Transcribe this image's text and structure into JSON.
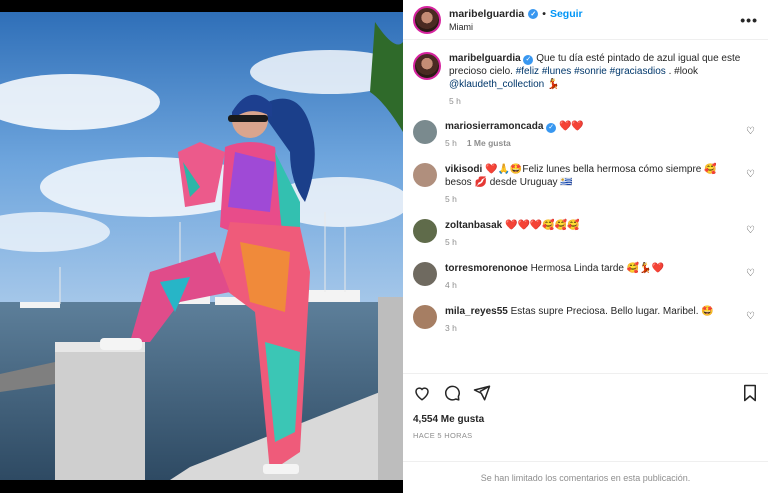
{
  "post": {
    "author": "maribelguardia",
    "follow_label": "Seguir",
    "location": "Miami",
    "more_icon": "more-options-icon"
  },
  "caption": {
    "author": "maribelguardia",
    "text_before": "Que tu día esté pintado de azul igual que este precioso cielo.",
    "hashtags": "#feliz #lunes #sonrie #graciasdios",
    "mid": ". #look",
    "mention": "@klaudeth_collection",
    "emoji": "💃",
    "time": "5 h"
  },
  "comments": [
    {
      "user": "mariosierramoncada",
      "verified": true,
      "text": "❤️❤️",
      "time": "5 h",
      "likes": "1 Me gusta",
      "avatar_color": "#7a8a8e"
    },
    {
      "user": "vikisodi",
      "verified": false,
      "text": "❤️🙏🤩Feliz lunes bella hermosa cómo siempre 🥰 besos 💋 desde Uruguay 🇺🇾",
      "time": "5 h",
      "likes": "",
      "avatar_color": "#b08f7d"
    },
    {
      "user": "zoltanbasak",
      "verified": false,
      "text": "❤️❤️❤️🥰🥰🥰",
      "time": "5 h",
      "likes": "",
      "avatar_color": "#5f6b4a"
    },
    {
      "user": "torresmorenonoe",
      "verified": false,
      "text": "Hermosa Linda tarde 🥰💃❤️",
      "time": "4 h",
      "likes": "",
      "avatar_color": "#6f6a60"
    },
    {
      "user": "mila_reyes55",
      "verified": false,
      "text": "Estas supre Preciosa. Bello lugar. Maribel. 🤩",
      "time": "3 h",
      "likes": "",
      "avatar_color": "#a67e63"
    }
  ],
  "footer": {
    "likes": "4,554 Me gusta",
    "when": "HACE 5 HORAS",
    "closed_msg": "Se han limitado los comentarios en esta publicación."
  },
  "colors": {
    "accent": "#0095f6",
    "sky": "#4a86c8",
    "water": "#3f5d78"
  }
}
